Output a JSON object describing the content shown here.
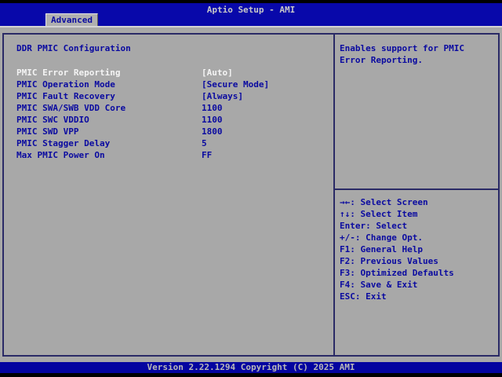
{
  "window": {
    "title": "Aptio Setup - AMI"
  },
  "tabs": {
    "advanced": {
      "label": "Advanced",
      "active": true
    }
  },
  "main": {
    "section_title": "DDR PMIC Configuration",
    "options": [
      {
        "label": "PMIC Error Reporting",
        "value": "[Auto]",
        "selected": true
      },
      {
        "label": "PMIC Operation Mode",
        "value": "[Secure Mode]",
        "selected": false
      },
      {
        "label": "PMIC Fault Recovery",
        "value": "[Always]",
        "selected": false
      },
      {
        "label": "PMIC SWA/SWB VDD Core",
        "value": "1100",
        "selected": false
      },
      {
        "label": "PMIC SWC VDDIO",
        "value": "1100",
        "selected": false
      },
      {
        "label": "PMIC SWD VPP",
        "value": "1800",
        "selected": false
      },
      {
        "label": "PMIC Stagger Delay",
        "value": "5",
        "selected": false
      },
      {
        "label": "Max PMIC Power On",
        "value": "FF",
        "selected": false
      }
    ]
  },
  "help": {
    "text": "Enables support for PMIC Error Reporting."
  },
  "hotkeys": [
    "→←: Select Screen",
    "↑↓: Select Item",
    "Enter: Select",
    "+/-: Change Opt.",
    "F1: General Help",
    "F2: Previous Values",
    "F3: Optimized Defaults",
    "F4: Save & Exit",
    "ESC: Exit"
  ],
  "footer": {
    "version": "Version 2.22.1294 Copyright (C) 2025 AMI"
  },
  "colors": {
    "header_blue": "#0808aa",
    "footer_blue": "#0404a0",
    "background_gray": "#a8a8a8",
    "text_blue": "#0a0aa0",
    "selected_text": "#f4f4f4",
    "border_navy": "#2a2a66",
    "title_text": "#c8c8c8"
  }
}
